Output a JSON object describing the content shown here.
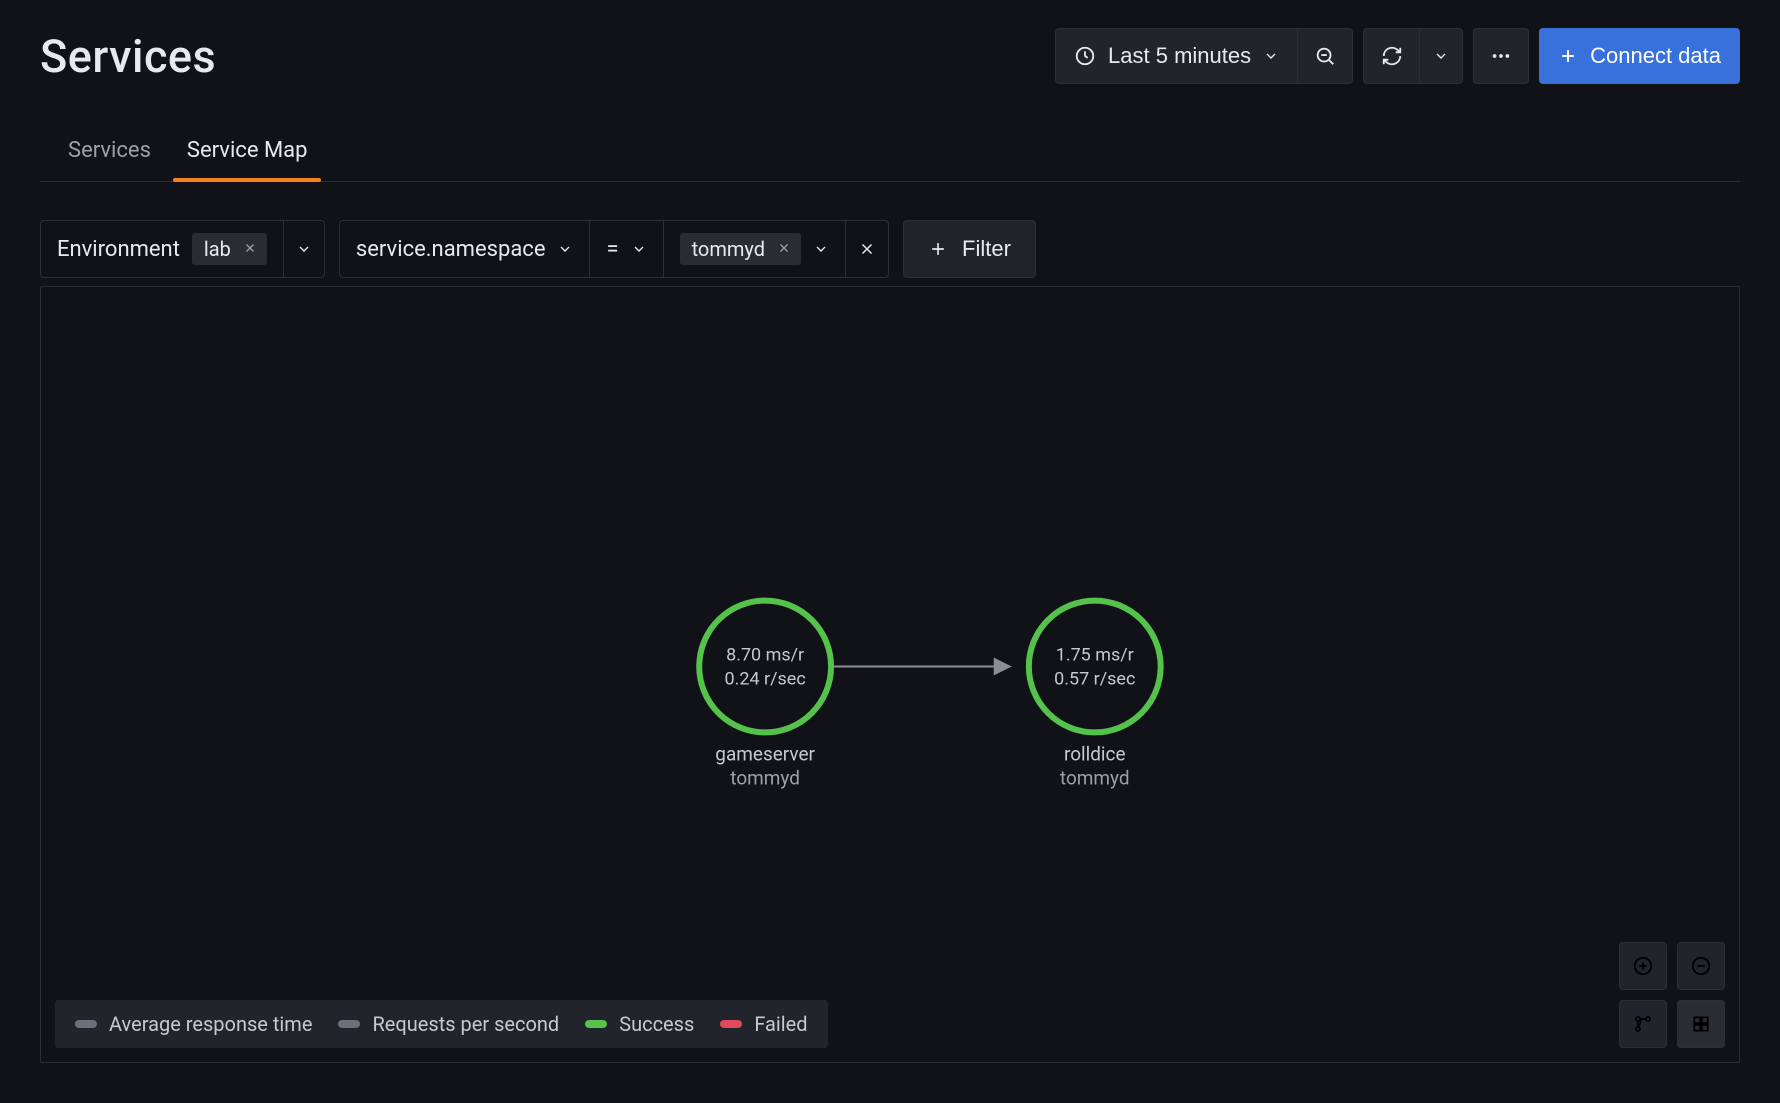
{
  "header": {
    "title": "Services",
    "time_range_label": "Last 5 minutes",
    "connect_data_label": "Connect data"
  },
  "tabs": {
    "items": [
      {
        "label": "Services",
        "active": false
      },
      {
        "label": "Service Map",
        "active": true
      }
    ]
  },
  "filters": {
    "environment_label": "Environment",
    "environment_value": "lab",
    "attribute_key": "service.namespace",
    "operator": "=",
    "attribute_value": "tommyd",
    "add_filter_label": "Filter"
  },
  "legend": {
    "avg_response_time": "Average response time",
    "requests_per_second": "Requests per second",
    "success": "Success",
    "failed": "Failed"
  },
  "nodes": {
    "gameserver": {
      "name": "gameserver",
      "namespace": "tommyd",
      "metric_top": "8.70 ms/r",
      "metric_bottom": "0.24 r/sec"
    },
    "rolldice": {
      "name": "rolldice",
      "namespace": "tommyd",
      "metric_top": "1.75 ms/r",
      "metric_bottom": "0.57 r/sec"
    }
  },
  "colors": {
    "success": "#55c24b",
    "failed": "#e0485b",
    "neutral": "#6d707a",
    "accent": "#3871dc",
    "tab_underline": "#f5821f"
  }
}
